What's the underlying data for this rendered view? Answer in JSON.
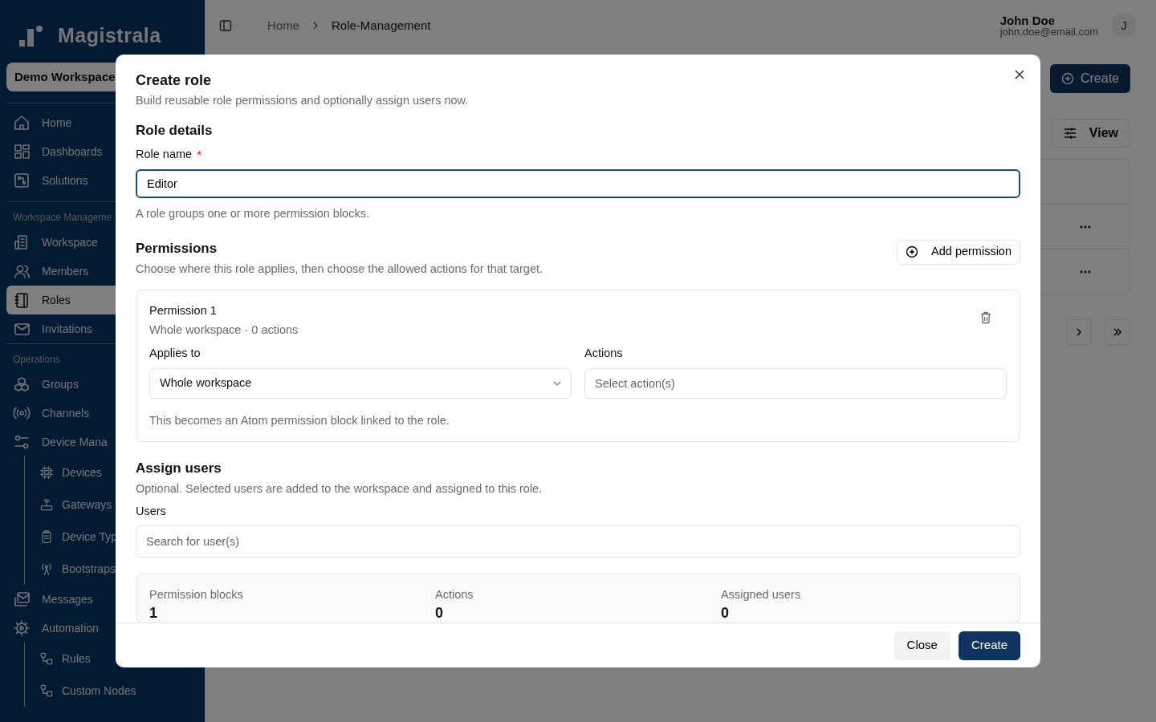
{
  "sidebar": {
    "logo": "Magistrala",
    "workspace": "Demo Workspace",
    "sections": [
      {
        "items": [
          {
            "label": "Home",
            "selected": false
          },
          {
            "label": "Dashboards",
            "selected": false
          },
          {
            "label": "Solutions",
            "selected": false
          }
        ]
      },
      {
        "heading": "Workspace Manageme",
        "items": [
          {
            "label": "Workspace",
            "selected": false
          },
          {
            "label": "Members",
            "selected": false
          },
          {
            "label": "Roles",
            "selected": true
          },
          {
            "label": "Invitations",
            "selected": false
          }
        ]
      },
      {
        "heading": "Operations",
        "items": [
          {
            "label": "Groups",
            "selected": false
          },
          {
            "label": "Channels",
            "selected": false
          },
          {
            "label": "Device Mana",
            "selected": false,
            "children": [
              {
                "label": "Devices",
                "selected": false
              },
              {
                "label": "Gateways",
                "selected": false
              },
              {
                "label": "Device Typ",
                "selected": false
              },
              {
                "label": "Bootstraps",
                "selected": false
              }
            ]
          },
          {
            "label": "Messages",
            "selected": false
          },
          {
            "label": "Automation",
            "selected": false,
            "children": [
              {
                "label": "Rules",
                "selected": false
              },
              {
                "label": "Custom Nodes",
                "selected": false
              }
            ]
          }
        ]
      }
    ]
  },
  "header": {
    "breadcrumb": [
      "Home",
      "Role-Management"
    ],
    "user": {
      "name": "John Doe",
      "email": "john.doe@email.com",
      "initial": "J"
    }
  },
  "page": {
    "create_button": "Create",
    "view_button": "View"
  },
  "dialog": {
    "title": "Create role",
    "subtitle": "Build reusable role permissions and optionally assign users now.",
    "role_details": {
      "heading": "Role details",
      "label": "Role name",
      "required_mark": "*",
      "value": "Editor",
      "focused": true,
      "help": "A role groups one or more permission blocks."
    },
    "permissions": {
      "heading": "Permissions",
      "subtitle": "Choose where this role applies, then choose the allowed actions for that target.",
      "add_button": "Add permission",
      "blocks": [
        {
          "title": "Permission 1",
          "summary": "Whole workspace · 0 actions",
          "applies_label": "Applies to",
          "applies_value": "Whole workspace",
          "actions_label": "Actions",
          "actions_placeholder": "Select action(s)",
          "note": "This becomes an Atom permission block linked to the role."
        }
      ]
    },
    "assign": {
      "heading": "Assign users",
      "subtitle": "Optional. Selected users are added to the workspace and assigned to this role.",
      "label": "Users",
      "placeholder": "Search for user(s)"
    },
    "stats": [
      {
        "label": "Permission blocks",
        "value": "1"
      },
      {
        "label": "Actions",
        "value": "0"
      },
      {
        "label": "Assigned users",
        "value": "0"
      }
    ],
    "buttons": {
      "close": "Close",
      "create": "Create"
    }
  }
}
